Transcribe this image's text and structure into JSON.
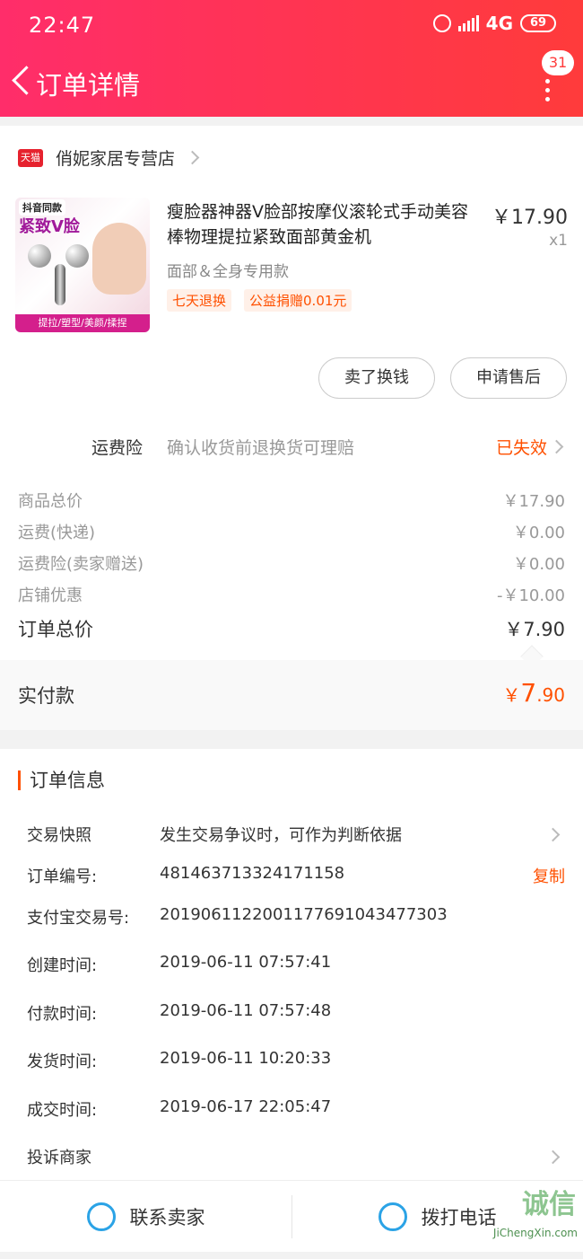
{
  "status_bar": {
    "time": "22:47",
    "network": "4G",
    "battery": "69"
  },
  "header": {
    "title": "订单详情",
    "message_badge": "31"
  },
  "store": {
    "badge": "天猫",
    "name": "俏妮家居专营店"
  },
  "product": {
    "image_tag_top": "抖音同款",
    "image_tag_main": "紧致V脸",
    "image_band": "提拉/塑型/美颜/揉捏",
    "title": "瘦脸器神器V脸部按摩仪滚轮式手动美容棒物理提拉紧致面部黄金机",
    "price": "￥17.90",
    "qty": "x1",
    "spec": "面部＆全身专用款",
    "tags": [
      "七天退换",
      "公益捐赠0.01元"
    ]
  },
  "buttons": {
    "sell": "卖了换钱",
    "after_sale": "申请售后"
  },
  "insurance": {
    "label": "运费险",
    "desc": "确认收货前退换货可理赔",
    "status": "已失效"
  },
  "fees": [
    {
      "label": "商品总价",
      "value": "￥17.90"
    },
    {
      "label": "运费(快递)",
      "value": "￥0.00"
    },
    {
      "label": "运费险(卖家赠送)",
      "value": "￥0.00"
    },
    {
      "label": "店铺优惠",
      "value": "-￥10.00"
    }
  ],
  "order_total": {
    "label": "订单总价",
    "value": "￥7.90"
  },
  "paid": {
    "label": "实付款",
    "currency": "￥",
    "int": "7",
    "dec": ".90"
  },
  "order_info": {
    "heading": "订单信息",
    "snapshot": {
      "key": "交易快照",
      "value": "发生交易争议时，可作为判断依据"
    },
    "order_no": {
      "key": "订单编号:",
      "value": "481463713324171158",
      "action": "复制"
    },
    "alipay_no": {
      "key": "支付宝交易号:",
      "value": "2019061122001177691043477303"
    },
    "created": {
      "key": "创建时间:",
      "value": "2019-06-11 07:57:41"
    },
    "paid_time": {
      "key": "付款时间:",
      "value": "2019-06-11 07:57:48"
    },
    "shipped": {
      "key": "发货时间:",
      "value": "2019-06-11 10:20:33"
    },
    "completed": {
      "key": "成交时间:",
      "value": "2019-06-17 22:05:47"
    },
    "complain": {
      "key": "投诉商家"
    }
  },
  "bottom_bar": {
    "contact": "联系卖家",
    "call": "拨打电话"
  },
  "watermark": {
    "text": "JiChengXin.com",
    "logo": "诚信"
  }
}
